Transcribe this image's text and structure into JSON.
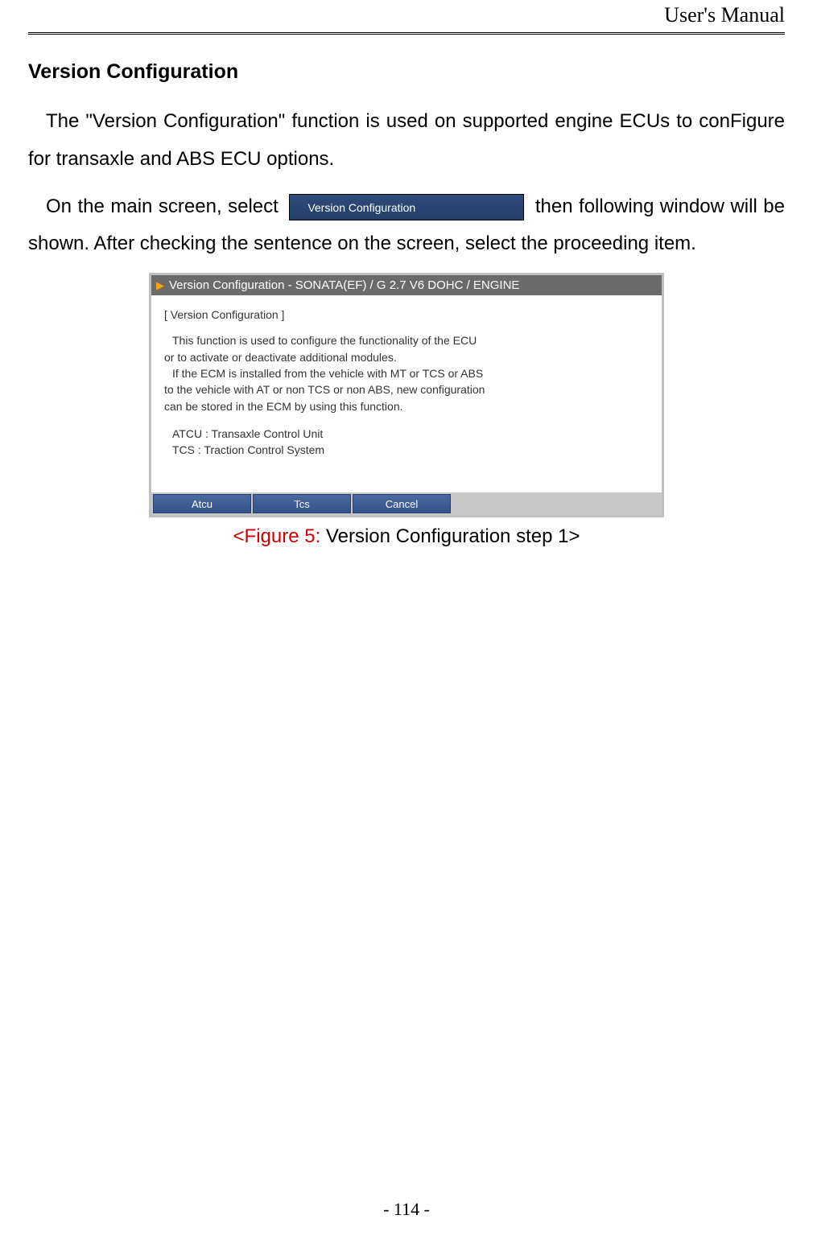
{
  "header": {
    "title": "User's Manual"
  },
  "section": {
    "title": "Version Configuration"
  },
  "para1": {
    "text": "The \"Version Configuration\" function is used on supported engine ECUs to conFigure for transaxle and ABS ECU options."
  },
  "para2": {
    "before": "On the main screen, select ",
    "button_label": "Version Configuration",
    "after": " then following window will be shown. After checking the sentence on the screen, select the proceeding item."
  },
  "screenshot": {
    "titlebar": "Version Configuration - SONATA(EF) / G 2.7 V6 DOHC / ENGINE",
    "heading": "[ Version Configuration ]",
    "lines": [
      "This function is used to configure the functionality of the ECU",
      "or to activate or deactivate additional modules.",
      "If the ECM is installed from the vehicle with MT or TCS or ABS",
      "to the vehicle with AT or non TCS or non ABS, new configuration",
      "can be stored in the ECM by using this function.",
      "",
      "ATCU : Transaxle Control Unit",
      "TCS : Traction Control System"
    ],
    "buttons": {
      "atcu": "Atcu",
      "tcs": "Tcs",
      "cancel": "Cancel"
    }
  },
  "caption": {
    "prefix": "<Figure 5: ",
    "rest": "Version Configuration step 1>"
  },
  "page_number": "- 114 -"
}
